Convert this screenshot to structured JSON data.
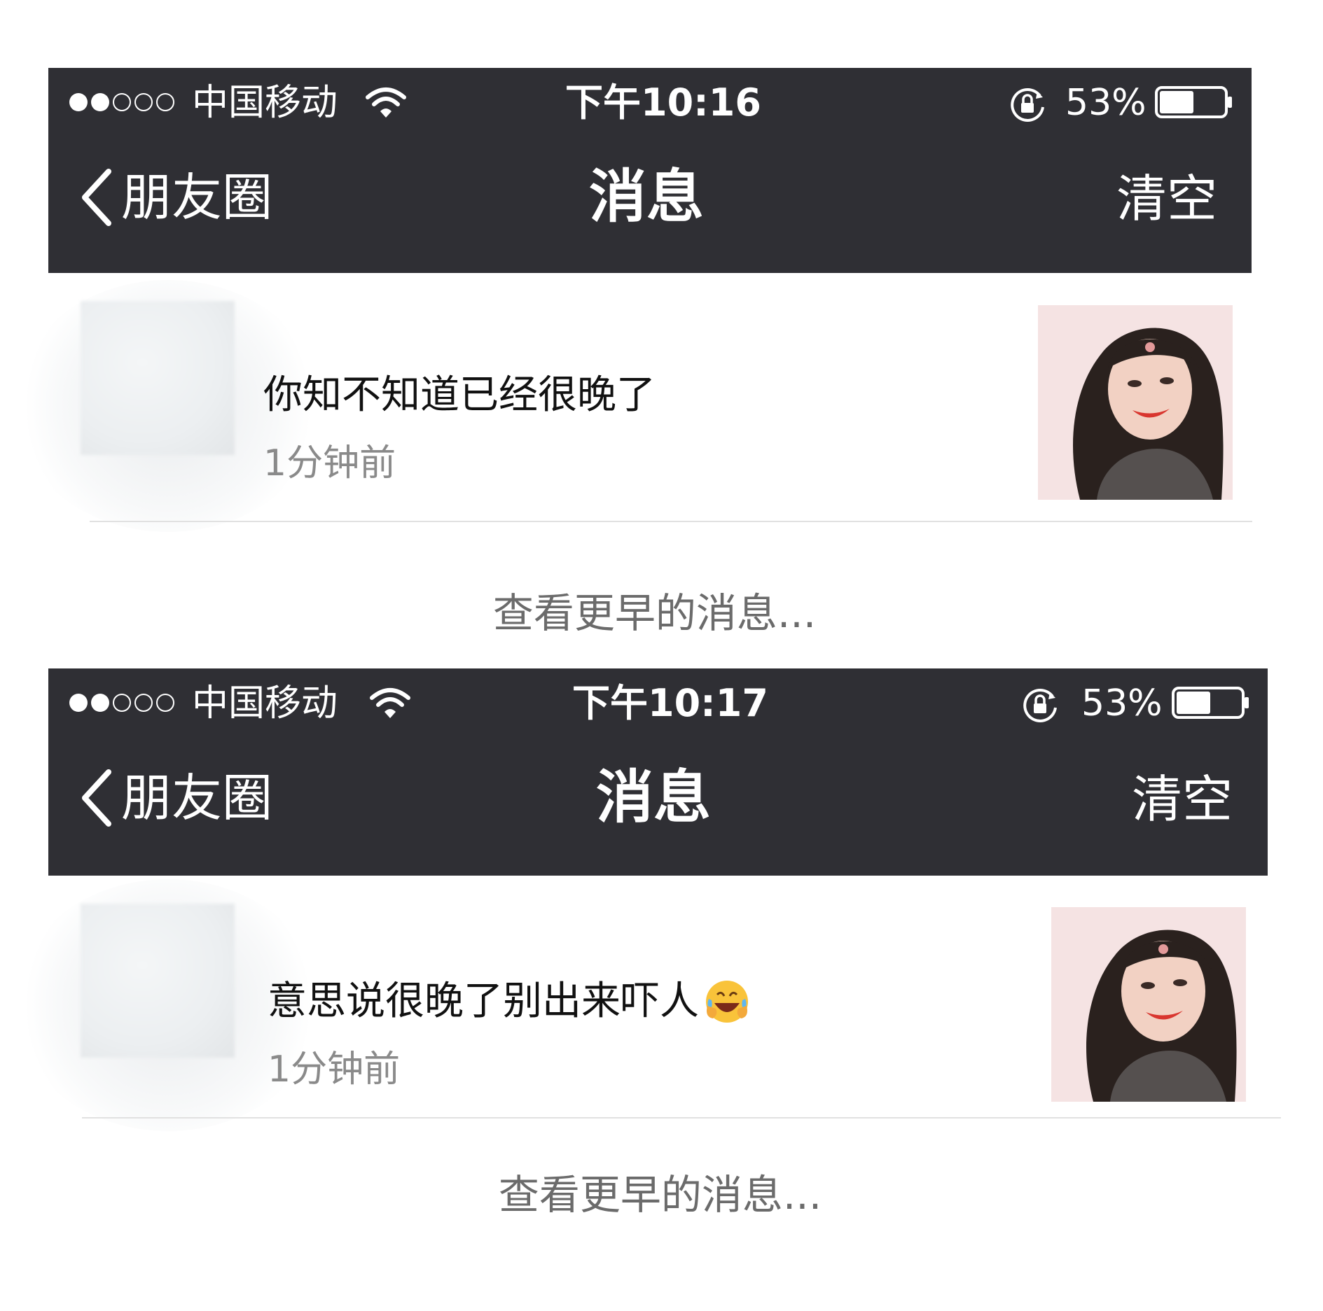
{
  "panels": [
    {
      "status_bar": {
        "signal_dots": [
          "full",
          "full",
          "empty",
          "empty",
          "empty"
        ],
        "carrier": "中国移动",
        "wifi_icon": "wifi-icon",
        "time": "下午10:16",
        "orientation_lock_icon": "orientation-lock-icon",
        "battery_percent": "53%",
        "battery_level": 0.53
      },
      "nav": {
        "back_icon": "chevron-left-icon",
        "back_label": "朋友圈",
        "title": "消息",
        "right_action": "清空"
      },
      "notifications": [
        {
          "message": "你知不知道已经很晚了",
          "time": "1分钟前"
        }
      ],
      "view_earlier": "查看更早的消息..."
    },
    {
      "status_bar": {
        "signal_dots": [
          "full",
          "full",
          "empty",
          "empty",
          "empty"
        ],
        "carrier": "中国移动",
        "wifi_icon": "wifi-icon",
        "time": "下午10:17",
        "orientation_lock_icon": "orientation-lock-icon",
        "battery_percent": "53%",
        "battery_level": 0.53
      },
      "nav": {
        "back_icon": "chevron-left-icon",
        "back_label": "朋友圈",
        "title": "消息",
        "right_action": "清空"
      },
      "notifications": [
        {
          "message": "意思说很晚了别出来吓人",
          "emoji": "laughing-crying-emoji",
          "time": "1分钟前"
        }
      ],
      "view_earlier": "查看更早的消息..."
    }
  ],
  "colors": {
    "header_bg": "#2f2f34",
    "header_text": "#ffffff",
    "timestamp": "#8a8a8a",
    "view_earlier": "#6b6b6b",
    "divider": "#e1e1e1"
  }
}
